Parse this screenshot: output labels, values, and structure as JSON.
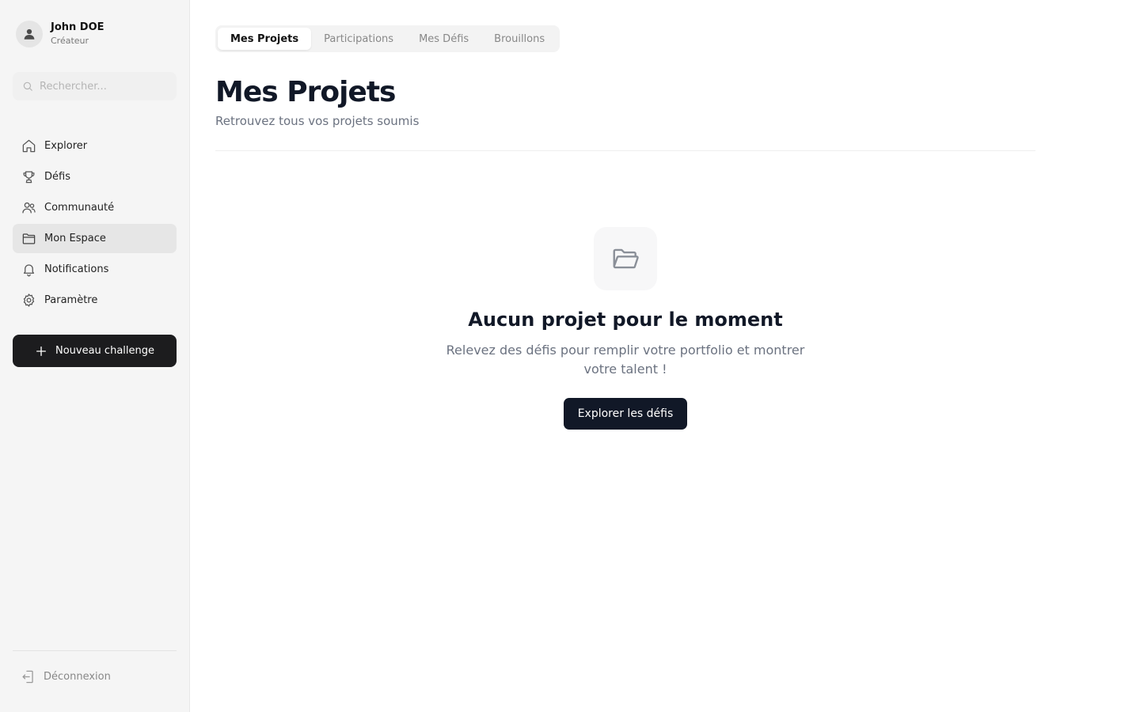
{
  "user": {
    "name": "John DOE",
    "role": "Créateur"
  },
  "search": {
    "placeholder": "Rechercher..."
  },
  "sidebar": {
    "items": [
      {
        "label": "Explorer",
        "icon": "home-icon"
      },
      {
        "label": "Défis",
        "icon": "trophy-icon"
      },
      {
        "label": "Communauté",
        "icon": "users-icon"
      },
      {
        "label": "Mon Espace",
        "icon": "folder-icon",
        "active": true
      },
      {
        "label": "Notifications",
        "icon": "bell-icon"
      },
      {
        "label": "Paramètre",
        "icon": "gear-icon"
      }
    ],
    "new_button": "Nouveau challenge",
    "logout": "Déconnexion"
  },
  "tabs": [
    {
      "label": "Mes Projets",
      "active": true
    },
    {
      "label": "Participations"
    },
    {
      "label": "Mes Défis"
    },
    {
      "label": "Brouillons"
    }
  ],
  "page": {
    "title": "Mes Projets",
    "subtitle": "Retrouvez tous vos projets soumis"
  },
  "empty_state": {
    "icon": "folder-open-icon",
    "title": "Aucun projet pour le moment",
    "text": "Relevez des défis pour remplir votre portfolio et montrer votre talent !",
    "button": "Explorer les défis"
  },
  "colors": {
    "sidebar_bg": "#f5f5f5",
    "active_item_bg": "#e6e6e6",
    "primary_dark": "#111827",
    "muted_text": "#6b7280"
  }
}
